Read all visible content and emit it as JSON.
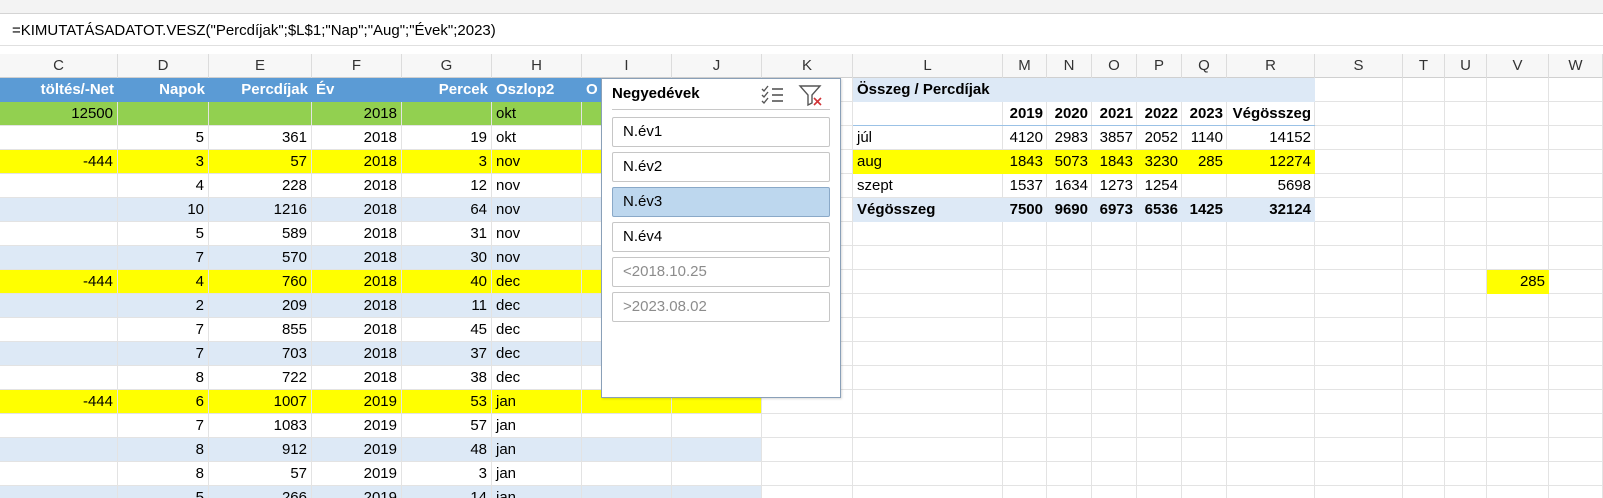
{
  "formula_bar": {
    "formula": "=KIMUTATÁSADATOT.VESZ(\"Percdíjak\";$L$1;\"Nap\";\"Aug\";\"Évek\";2023)"
  },
  "column_headers": [
    "C",
    "D",
    "E",
    "F",
    "G",
    "H",
    "I",
    "J",
    "K",
    "L",
    "M",
    "N",
    "O",
    "P",
    "Q",
    "R",
    "S",
    "T",
    "U",
    "V",
    "W"
  ],
  "table": {
    "headers": {
      "C": "töltés/-Net",
      "D": "Napok",
      "E": "Percdíjak",
      "F": "Év",
      "G": "Percek",
      "H": "Oszlop2",
      "I": "O"
    },
    "rows": [
      {
        "style": "green",
        "C": "12500",
        "D": "",
        "E": "",
        "F": "2018",
        "G": "",
        "H": "okt"
      },
      {
        "style": "plain",
        "C": "",
        "D": "5",
        "E": "361",
        "F": "2018",
        "G": "19",
        "H": "okt"
      },
      {
        "style": "yellow",
        "C": "-444",
        "D": "3",
        "E": "57",
        "F": "2018",
        "G": "3",
        "H": "nov"
      },
      {
        "style": "plain",
        "C": "",
        "D": "4",
        "E": "228",
        "F": "2018",
        "G": "12",
        "H": "nov"
      },
      {
        "style": "band",
        "C": "",
        "D": "10",
        "E": "1216",
        "F": "2018",
        "G": "64",
        "H": "nov"
      },
      {
        "style": "plain",
        "C": "",
        "D": "5",
        "E": "589",
        "F": "2018",
        "G": "31",
        "H": "nov"
      },
      {
        "style": "band",
        "C": "",
        "D": "7",
        "E": "570",
        "F": "2018",
        "G": "30",
        "H": "nov"
      },
      {
        "style": "yellow",
        "C": "-444",
        "D": "4",
        "E": "760",
        "F": "2018",
        "G": "40",
        "H": "dec"
      },
      {
        "style": "band",
        "C": "",
        "D": "2",
        "E": "209",
        "F": "2018",
        "G": "11",
        "H": "dec"
      },
      {
        "style": "plain",
        "C": "",
        "D": "7",
        "E": "855",
        "F": "2018",
        "G": "45",
        "H": "dec"
      },
      {
        "style": "band",
        "C": "",
        "D": "7",
        "E": "703",
        "F": "2018",
        "G": "37",
        "H": "dec"
      },
      {
        "style": "plain",
        "C": "",
        "D": "8",
        "E": "722",
        "F": "2018",
        "G": "38",
        "H": "dec"
      },
      {
        "style": "yellow",
        "C": "-444",
        "D": "6",
        "E": "1007",
        "F": "2019",
        "G": "53",
        "H": "jan"
      },
      {
        "style": "plain",
        "C": "",
        "D": "7",
        "E": "1083",
        "F": "2019",
        "G": "57",
        "H": "jan"
      },
      {
        "style": "band",
        "C": "",
        "D": "8",
        "E": "912",
        "F": "2019",
        "G": "48",
        "H": "jan"
      },
      {
        "style": "plain",
        "C": "",
        "D": "8",
        "E": "57",
        "F": "2019",
        "G": "3",
        "H": "jan"
      },
      {
        "style": "band",
        "C": "",
        "D": "5",
        "E": "266",
        "F": "2019",
        "G": "14",
        "H": "jan"
      }
    ]
  },
  "slicer": {
    "title": "Negyedévek",
    "items": [
      {
        "label": "N.év1",
        "selected": false,
        "dim": false
      },
      {
        "label": "N.év2",
        "selected": false,
        "dim": false
      },
      {
        "label": "N.év3",
        "selected": true,
        "dim": false
      },
      {
        "label": "N.év4",
        "selected": false,
        "dim": false
      },
      {
        "label": "<2018.10.25",
        "selected": false,
        "dim": true
      },
      {
        "label": ">2023.08.02",
        "selected": false,
        "dim": true
      }
    ],
    "icons": [
      "multi-select-icon",
      "clear-filter-icon"
    ]
  },
  "pivot": {
    "title": "Összeg / Percdíjak",
    "years": [
      "2019",
      "2020",
      "2021",
      "2022",
      "2023"
    ],
    "total_label": "Végösszeg",
    "rows": [
      {
        "label": "júl",
        "values": [
          "4120",
          "2983",
          "3857",
          "2052",
          "1140"
        ],
        "total": "14152",
        "style": "plain"
      },
      {
        "label": "aug",
        "values": [
          "1843",
          "5073",
          "1843",
          "3230",
          "285"
        ],
        "total": "12274",
        "style": "yellow"
      },
      {
        "label": "szept",
        "values": [
          "1537",
          "1634",
          "1273",
          "1254",
          ""
        ],
        "total": "5698",
        "style": "plain"
      }
    ],
    "grand_total": {
      "label": "Végösszeg",
      "values": [
        "7500",
        "9690",
        "6973",
        "6536",
        "1425"
      ],
      "total": "32124"
    }
  },
  "cell_V": {
    "value": "285",
    "color": "#ffff00"
  },
  "colors": {
    "table_header": "#5b9bd5",
    "band": "#dde9f6",
    "highlight": "#ffff00",
    "green": "#92d050",
    "slicer_selected": "#bdd7ee"
  }
}
